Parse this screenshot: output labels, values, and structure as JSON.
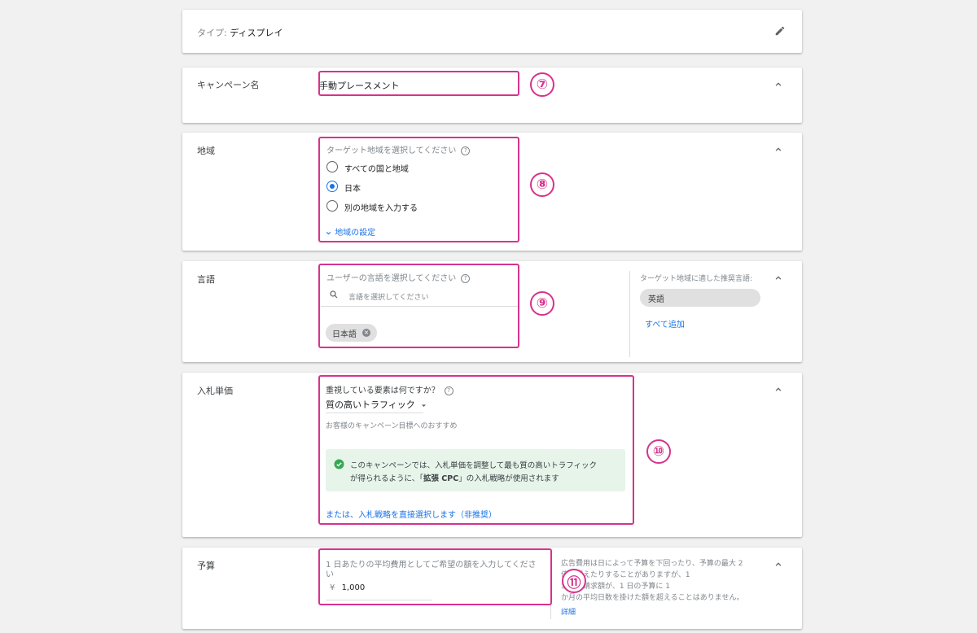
{
  "type_card": {
    "label": "タイプ:",
    "value": "ディスプレイ"
  },
  "campaign_name": {
    "label": "キャンペーン名",
    "value": "手動プレースメント",
    "badge": "⑦"
  },
  "region": {
    "label": "地域",
    "question": "ターゲット地域を選択してください",
    "options": [
      {
        "label": "すべての国と地域",
        "selected": false
      },
      {
        "label": "日本",
        "selected": true
      },
      {
        "label": "別の地域を入力する",
        "selected": false
      }
    ],
    "settings_link": "地域の設定",
    "badge": "⑧"
  },
  "language": {
    "label": "言語",
    "question": "ユーザーの言語を選択してください",
    "search_placeholder": "言語を選択してください",
    "selected_chip": "日本語",
    "recommend_title": "ターゲット地域に適した推奨言語:",
    "recommend_chip": "英語",
    "add_all": "すべて追加",
    "badge": "⑨"
  },
  "bid": {
    "label": "入札単価",
    "question": "重視している要素は何ですか？",
    "dropdown_value": "質の高いトラフィック",
    "recommend_text": "お客様のキャンペーン目標へのおすすめ",
    "info_line1": "このキャンペーンでは、入札単価を調整して最も質の高いトラフィック",
    "info_line2_pre": "が得られるように、「",
    "info_line2_bold": "拡張 CPC",
    "info_line2_post": "」の入札戦略が使用されます",
    "direct_link": "または、入札戦略を直接選択します（非推奨）",
    "badge": "⑩"
  },
  "budget": {
    "label": "予算",
    "question_line1": "1 日あたりの平均費用としてご希望の額を入力してくださ",
    "question_line2": "い",
    "currency": "¥",
    "amount": "1,000",
    "note_line1": "広告費用は日によって予算を下回ったり、予算の最大 2",
    "note_line2": "倍を超えたりすることがありますが、1",
    "note_line3": "か月の請求額が、1 日の予算に 1",
    "note_line4": "か月の平均日数を掛けた額を超えることはありません。",
    "details_link": "詳細",
    "badge": "⑪"
  },
  "colors": {
    "highlight": "#d6338d",
    "link": "#1a73e8",
    "success": "#34a853",
    "info_bg": "#e6f4ea"
  }
}
